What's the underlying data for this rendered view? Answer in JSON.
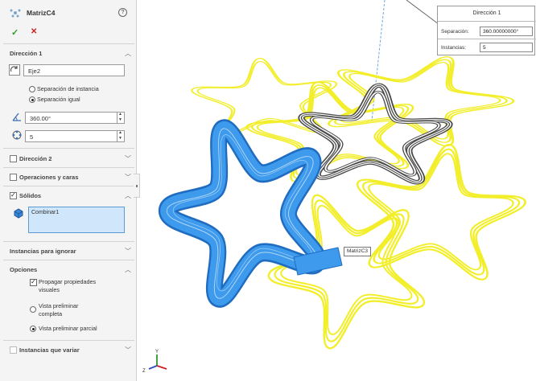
{
  "panel": {
    "title": "MatrizC4",
    "help_glyph": "?",
    "ok_glyph": "✓",
    "cancel_glyph": "✕",
    "direction1": {
      "header": "Dirección 1",
      "axis_value": "Eje2",
      "option_instance_spacing": "Separación de instancia",
      "option_equal_spacing": "Separación igual",
      "selected_option": "Separación igual",
      "angle_value": "360.00°",
      "instances_value": "5"
    },
    "direction2": {
      "header": "Dirección 2",
      "checked": false
    },
    "features": {
      "header": "Operaciones y caras",
      "checked": false
    },
    "bodies": {
      "header": "Sólidos",
      "checked": true,
      "selection": "Combinar1"
    },
    "skip": {
      "header": "Instancias para ignorar"
    },
    "options": {
      "header": "Opciones",
      "propagate_line1": "Propagar propiedades",
      "propagate_line2": "visuales",
      "propagate_checked": true,
      "full_preview_line1": "Vista preliminar",
      "full_preview_line2": "completa",
      "partial_preview": "Vista preliminar parcial",
      "selected_preview": "Vista preliminar parcial"
    },
    "vary": {
      "header": "Instancias que variar"
    }
  },
  "callout": {
    "title": "Dirección 1",
    "spacing_label": "Separación:",
    "spacing_value": "360.00000000°",
    "instances_label": "Instancias:",
    "instances_value": "5"
  },
  "viewport": {
    "tag_label": "MatrizC3",
    "colors": {
      "yellow": "#f2ee2a",
      "blue": "#2f8fe0",
      "dark": "#4a4a4a"
    }
  }
}
